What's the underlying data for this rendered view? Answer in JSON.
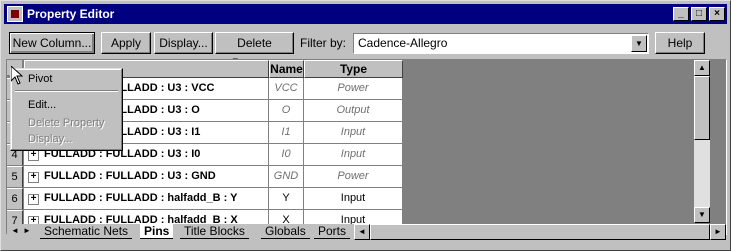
{
  "window": {
    "title": "Property Editor"
  },
  "toolbar": {
    "new_column": "New Column...",
    "apply": "Apply",
    "display": "Display...",
    "delete_property": "Delete Property",
    "filter_label": "Filter by:",
    "filter_value": "Cadence-Allegro",
    "help": "Help"
  },
  "grid": {
    "columns": {
      "name": "Name",
      "type": "Type"
    },
    "rows": [
      {
        "num": "",
        "label": "FULLADD : FULLADD : U3 : VCC",
        "name": "VCC",
        "type": "Power",
        "italic": true
      },
      {
        "num": "",
        "label": "FULLADD : FULLADD : U3 : O",
        "name": "O",
        "type": "Output",
        "italic": true
      },
      {
        "num": "",
        "label": "FULLADD : FULLADD : U3 : I1",
        "name": "I1",
        "type": "Input",
        "italic": true
      },
      {
        "num": "4",
        "label": "FULLADD : FULLADD : U3 : I0",
        "name": "I0",
        "type": "Input",
        "italic": true
      },
      {
        "num": "5",
        "label": "FULLADD : FULLADD : U3 : GND",
        "name": "GND",
        "type": "Power",
        "italic": true
      },
      {
        "num": "6",
        "label": "FULLADD : FULLADD : halfadd_B : Y",
        "name": "Y",
        "type": "Input",
        "italic": false
      },
      {
        "num": "7",
        "label": "FULLADD : FULLADD : halfadd_B : X",
        "name": "X",
        "type": "Input",
        "italic": false
      }
    ]
  },
  "tabs": [
    "Schematic Nets",
    "Pins",
    "Title Blocks",
    "Globals",
    "Ports"
  ],
  "active_tab": "Pins",
  "context_menu": {
    "pivot": "Pivot",
    "edit": "Edit...",
    "delete_property": "Delete Property",
    "display": "Display..."
  }
}
